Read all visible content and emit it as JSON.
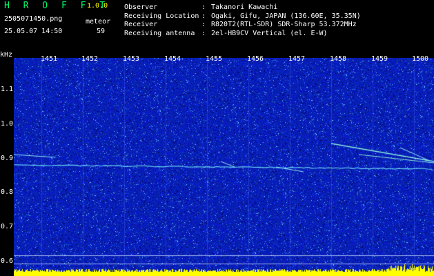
{
  "header": {
    "title": "H R O F F T",
    "version": "1.0.0",
    "filename": "2505071450.png",
    "datetime": "25.05.07 14:50",
    "meteor_label": "meteor",
    "meteor_count": "59"
  },
  "info": [
    {
      "label": "Observer",
      "sep": ":",
      "value": "Takanori Kawachi"
    },
    {
      "label": "Receiving Location",
      "sep": ":",
      "value": "Ogaki, Gifu, JAPAN (136.60E, 35.35N)"
    },
    {
      "label": "Receiver",
      "sep": ":",
      "value": "R820T2(RTL-SDR) SDR-Sharp 53.372MHz"
    },
    {
      "label": "Receiving antenna",
      "sep": ":",
      "value": "2el-HB9CV Vertical (el. E-W)"
    }
  ],
  "axis": {
    "y_unit": "kHz",
    "y_ticks": [
      "1.1",
      "1.0",
      "0.9",
      "0.8",
      "0.7",
      "0.6"
    ],
    "x_ticks": [
      "1451",
      "1452",
      "1453",
      "1454",
      "1455",
      "1456",
      "1457",
      "1458",
      "1459",
      "1500"
    ]
  },
  "colors": {
    "background": "#000000",
    "plot_noise": "#0a1ec8",
    "trace": "#00ffff",
    "title": "#00ff66",
    "version": "#ffff00",
    "bottom_bar": "#ffff00"
  }
}
